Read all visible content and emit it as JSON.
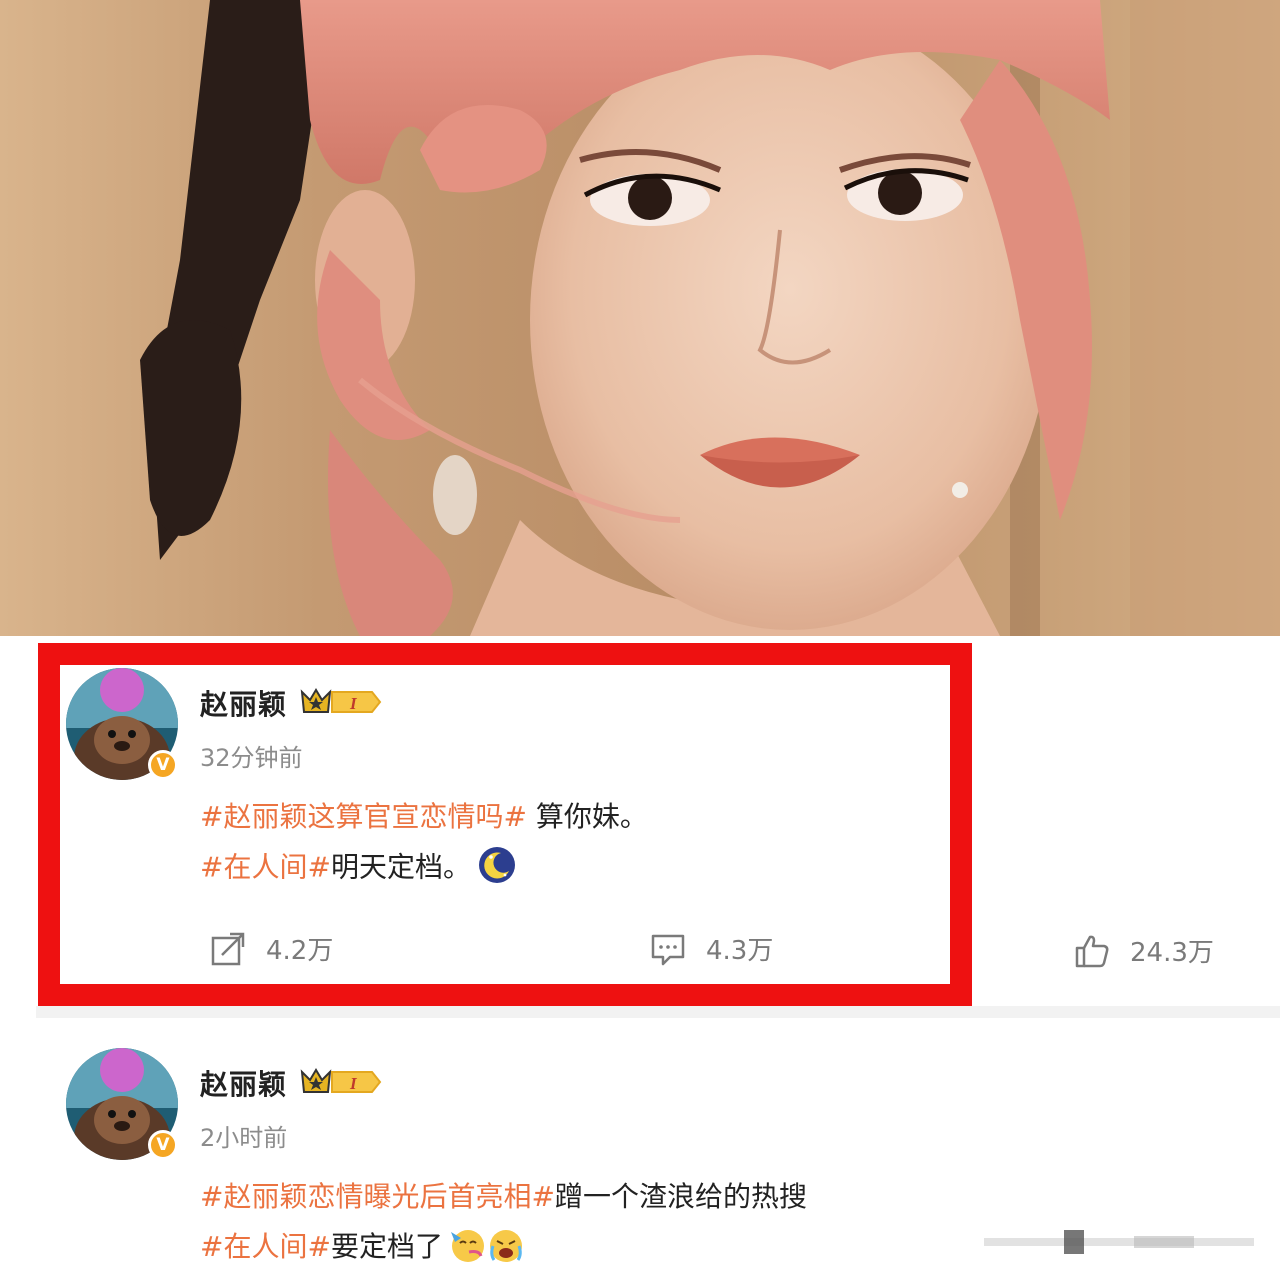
{
  "photo": {
    "description_icon": "portrait-photo"
  },
  "posts": [
    {
      "author": "赵丽颖",
      "time": "32分钟前",
      "line1": {
        "tag": "#赵丽颖这算官宣恋情吗#",
        "text": " 算你妹。"
      },
      "line2": {
        "tag": "#在人间#",
        "text": "明天定档。"
      },
      "actions": {
        "repost": "4.2万",
        "comment": "4.3万",
        "like": "24.3万"
      }
    },
    {
      "author": "赵丽颖",
      "time": "2小时前",
      "line1": {
        "tag": "#赵丽颖恋情曝光后首亮相#",
        "text": "蹭一个渣浪给的热搜"
      },
      "line2": {
        "tag": "#在人间#",
        "text": "要定档了"
      }
    }
  ],
  "badge_text": "V",
  "colors": {
    "highlight": "#ee1111",
    "tag": "#eb7340",
    "verified": "#f5a623"
  }
}
